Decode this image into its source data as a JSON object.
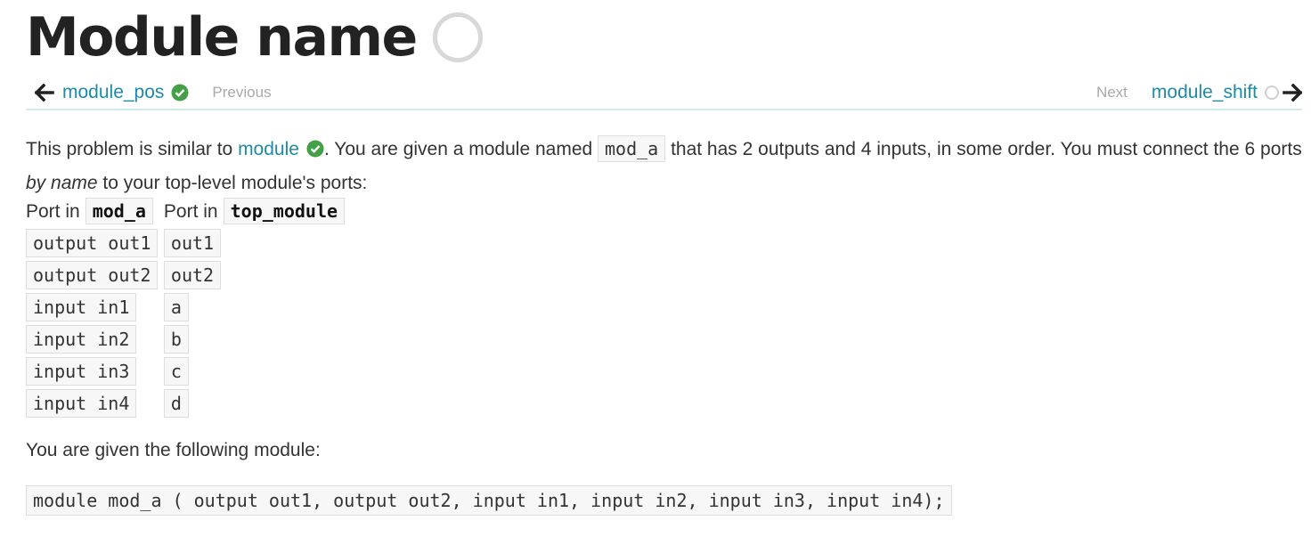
{
  "header": {
    "title": "Module name"
  },
  "nav": {
    "prev_link": "module_pos",
    "prev_hint": "Previous",
    "next_hint": "Next",
    "next_link": "module_shift"
  },
  "intro": {
    "text_1": "This problem is similar to ",
    "link": "module",
    "text_2": ". You are given a module named ",
    "code_module": "mod_a",
    "text_3": " that has 2 outputs and 4 inputs, in some order. You must connect the 6 ports ",
    "emphasis": "by name",
    "text_4": " to your top-level module's ports:"
  },
  "table": {
    "header_prefix_1": "Port in",
    "header_code_1": "mod_a",
    "header_prefix_2": "Port in",
    "header_code_2": "top_module",
    "rows": [
      {
        "mod_a": "output out1",
        "top": "out1"
      },
      {
        "mod_a": "output out2",
        "top": "out2"
      },
      {
        "mod_a": "input in1",
        "top": "a"
      },
      {
        "mod_a": "input in2",
        "top": "b"
      },
      {
        "mod_a": "input in3",
        "top": "c"
      },
      {
        "mod_a": "input in4",
        "top": "d"
      }
    ]
  },
  "given": {
    "text": "You are given the following module:",
    "code": "module mod_a ( output out1, output out2, input in1, input in2, input in3, input in4);"
  },
  "colors": {
    "link": "#1e8aa6",
    "check": "#43a047",
    "ring": "#d8d8d8",
    "nav_rule": "#d3eaec"
  }
}
